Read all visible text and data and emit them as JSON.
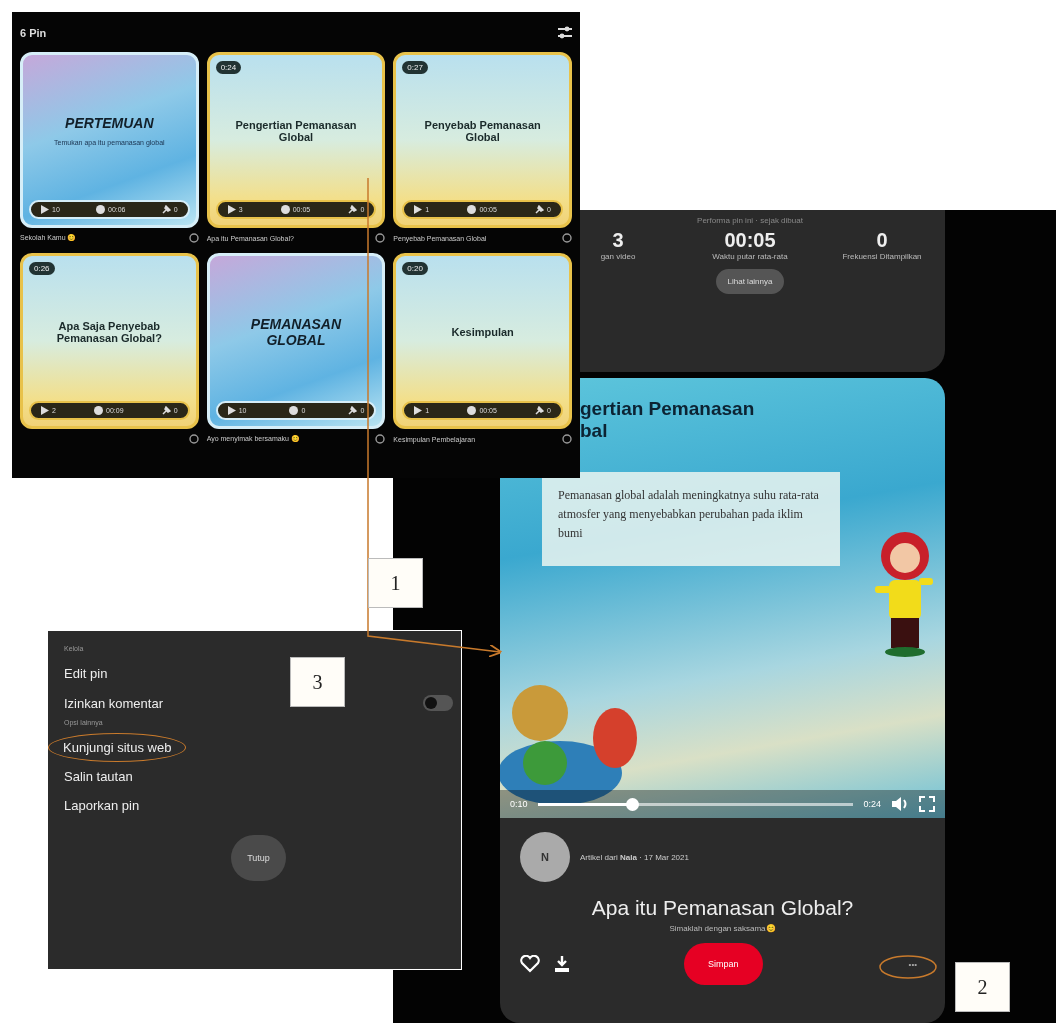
{
  "pin_grid": {
    "title": "6 Pin",
    "pins": [
      {
        "kind": "blue",
        "slide_title": "PERTEMUAN",
        "slide_subtitle": "Temukan apa itu pemanasan global",
        "stats": [
          "10",
          "00:06",
          "0"
        ],
        "caption": "Sekolah Kamu 😊"
      },
      {
        "kind": "yellow",
        "duration": "0:24",
        "slide_title": "Pengertian Pemanasan Global",
        "stats": [
          "3",
          "00:05",
          "0"
        ],
        "caption": "Apa itu Pemanasan Global?"
      },
      {
        "kind": "yellow",
        "duration": "0:27",
        "slide_title": "Penyebab Pemanasan Global",
        "stats": [
          "1",
          "00:05",
          "0"
        ],
        "caption": "Penyebab Pemanasan Global"
      },
      {
        "kind": "yellow",
        "duration": "0:26",
        "slide_title": "Apa Saja Penyebab Pemanasan Global?",
        "stats": [
          "2",
          "00:09",
          "0"
        ]
      },
      {
        "kind": "blue",
        "slide_title": "PEMANASAN GLOBAL",
        "stats": [
          "10",
          "0",
          "0"
        ],
        "caption": "Ayo menyimak bersamaku 😊"
      },
      {
        "kind": "yellow",
        "duration": "0:20",
        "slide_title": "Kesimpulan",
        "stats": [
          "1",
          "00:05",
          "0"
        ],
        "caption": "Kesimpulan Pembelajaran"
      }
    ]
  },
  "pin_detail": {
    "performance_caption": "Performa pin ini · sejak dibuat",
    "metrics": [
      {
        "value": "3",
        "label": "gan video"
      },
      {
        "value": "00:05",
        "label": "Waktu putar rata-rata"
      },
      {
        "value": "0",
        "label": "Frekuensi Ditampilkan"
      }
    ],
    "more_button": "Lihat lainnya",
    "video": {
      "title_lines": [
        "gertian Pemanasan",
        "bal"
      ],
      "text": "Pemanasan global adalah meningkatnya suhu rata-rata atmosfer yang menyebabkan perubahan pada iklim bumi",
      "elapsed": "0:10",
      "level": 0.3,
      "remaining": "0:24"
    },
    "avatar": "N",
    "byline": "Artikel dari **Nala** · 17 Mar 2021",
    "title": "Apa itu Pemanasan Global?",
    "description": "Simaklah dengan saksama😊",
    "save_button": "Simpan",
    "more_icon": "•••"
  },
  "menu": {
    "sections": [
      {
        "heading": "Kelola",
        "items": [
          {
            "label": "Edit pin"
          },
          {
            "label": "Izinkan komentar",
            "kind": "toggle",
            "on": false
          }
        ]
      },
      {
        "heading": "Opsi lainnya",
        "items": [
          {
            "label": "Kunjungi situs web",
            "circled": true
          },
          {
            "label": "Salin tautan"
          },
          {
            "label": "Laporkan pin"
          }
        ]
      }
    ],
    "close_button": "Tutup"
  },
  "callouts": [
    "1",
    "2",
    "3"
  ]
}
